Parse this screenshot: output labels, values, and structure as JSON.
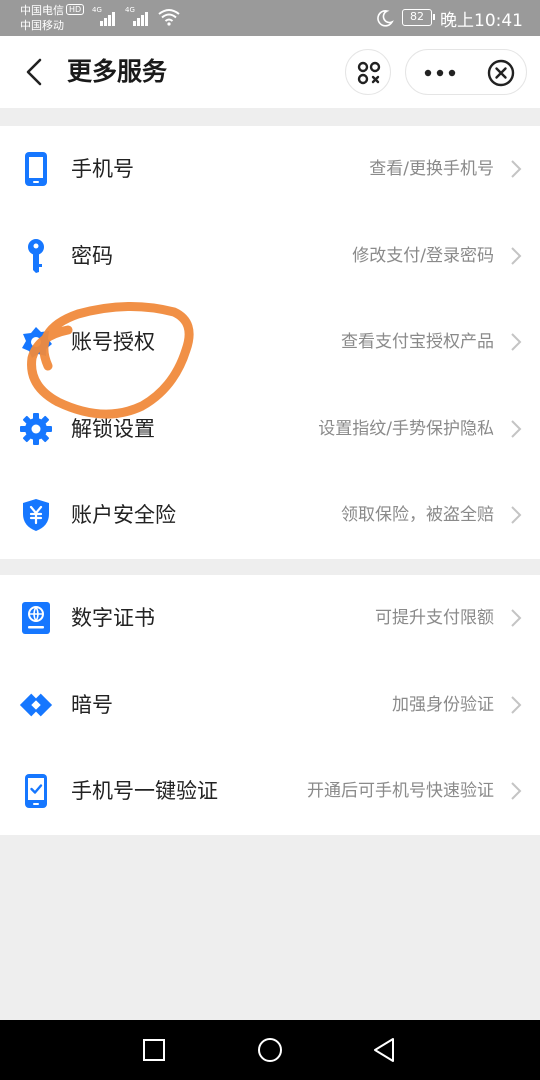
{
  "status_bar": {
    "carrier1": "中国电信",
    "carrier1_badge": "HD",
    "carrier2": "中国移动",
    "network1": "4G",
    "network2": "4G",
    "battery": "82",
    "time": "晚上10:41"
  },
  "header": {
    "title": "更多服务",
    "back_icon": "chevron-left-icon",
    "scan_icon": "scan-icon",
    "more_icon": "more-dots-icon",
    "close_icon": "close-circle-icon"
  },
  "section1": {
    "items": [
      {
        "label": "手机号",
        "desc": "查看/更换手机号",
        "icon": "phone-icon"
      },
      {
        "label": "密码",
        "desc": "修改支付/登录密码",
        "icon": "key-icon"
      },
      {
        "label": "账号授权",
        "desc": "查看支付宝授权产品",
        "icon": "authorization-icon"
      },
      {
        "label": "解锁设置",
        "desc": "设置指纹/手势保护隐私",
        "icon": "gear-icon"
      },
      {
        "label": "账户安全险",
        "desc": "领取保险，被盗全赔",
        "icon": "shield-yuan-icon"
      }
    ]
  },
  "section2": {
    "items": [
      {
        "label": "数字证书",
        "desc": "可提升支付限额",
        "icon": "certificate-icon"
      },
      {
        "label": "暗号",
        "desc": "加强身份验证",
        "icon": "code-diamond-icon"
      },
      {
        "label": "手机号一键验证",
        "desc": "开通后可手机号快速验证",
        "icon": "phone-check-icon"
      }
    ]
  },
  "colors": {
    "accent": "#1677ff",
    "annotation": "#f08a3c",
    "status_bar": "#9a9a9a"
  }
}
